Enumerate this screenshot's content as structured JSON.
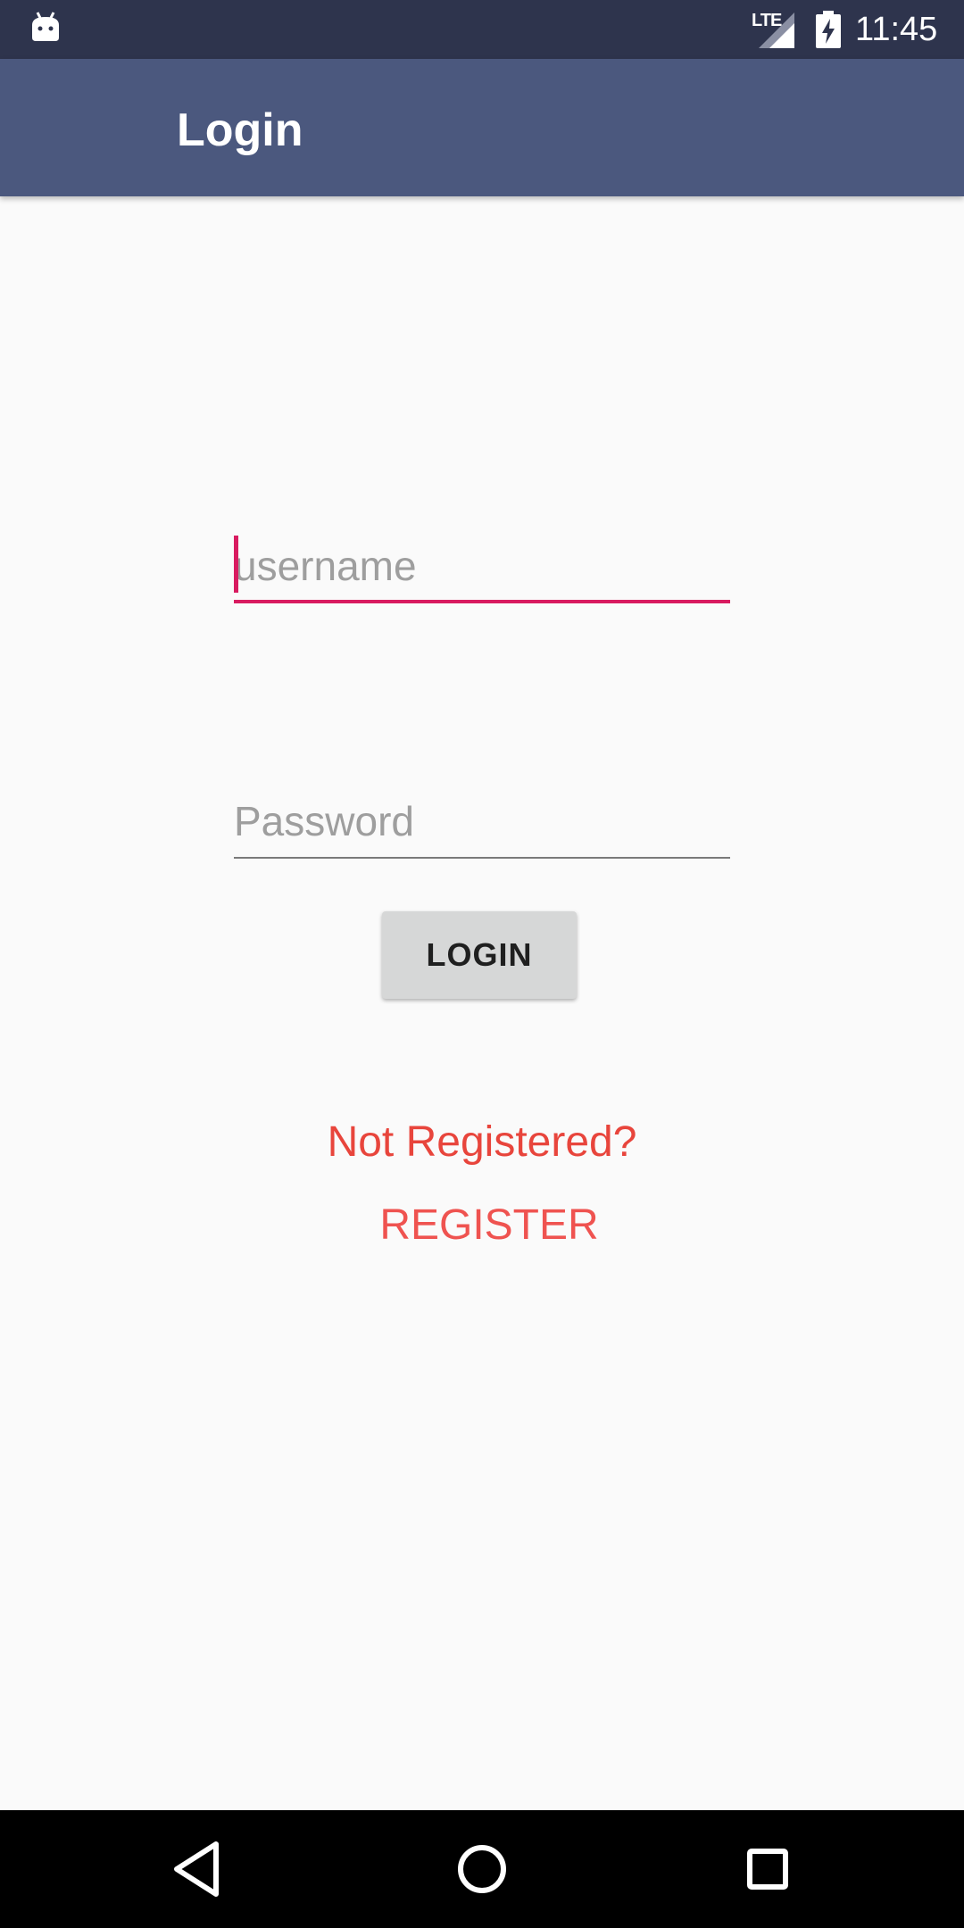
{
  "status_bar": {
    "time": "11:45",
    "network": "LTE",
    "icons": [
      "android-icon",
      "signal-icon",
      "battery-charging-icon"
    ]
  },
  "app_bar": {
    "title": "Login"
  },
  "form": {
    "username_placeholder": "username",
    "username_value": "",
    "password_placeholder": "Password",
    "password_value": "",
    "login_label": "LOGIN"
  },
  "register": {
    "prompt": "Not Registered?",
    "link_label": "REGISTER"
  },
  "nav_bar": {
    "icons": [
      "back-icon",
      "home-icon",
      "recents-icon"
    ]
  },
  "colors": {
    "status_bar": "#2e344d",
    "app_bar": "#4b587e",
    "accent": "#d81b60",
    "register_text": "#e8453c",
    "background": "#fafafa"
  }
}
